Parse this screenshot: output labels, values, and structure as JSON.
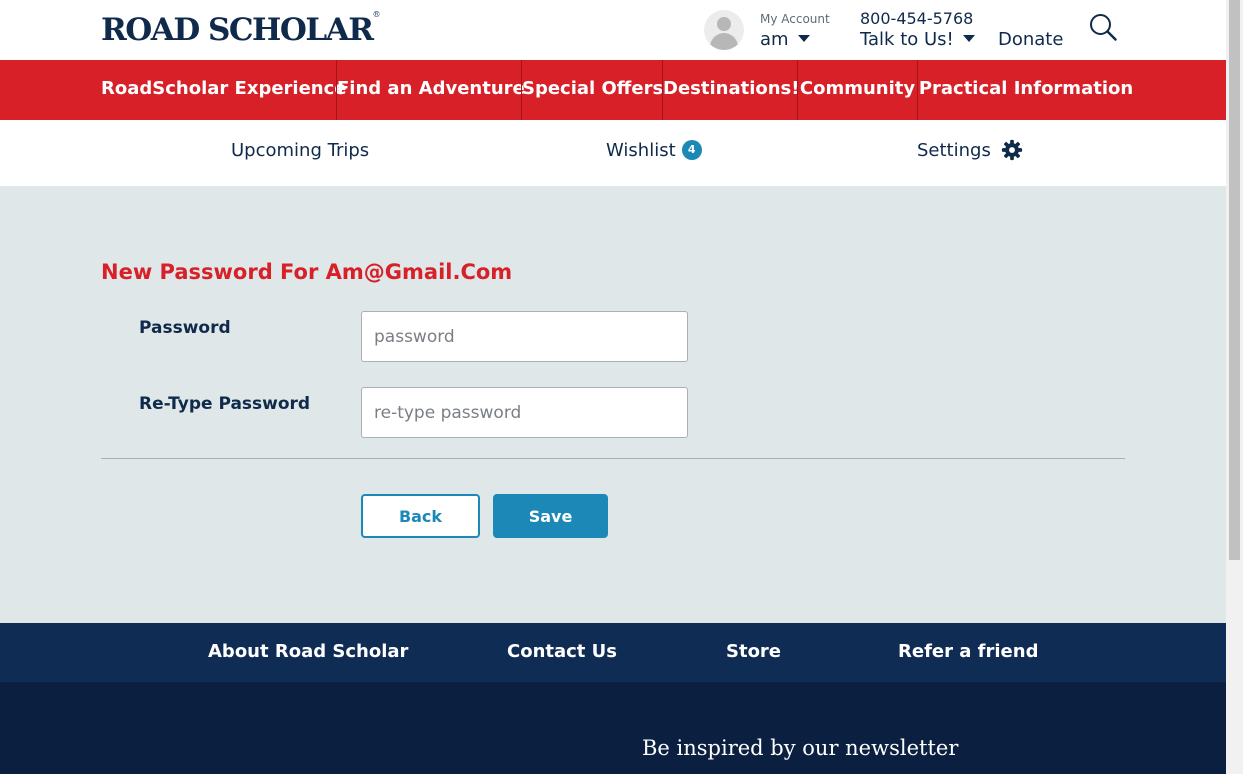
{
  "header": {
    "logo_text": "ROAD SCHOLAR",
    "logo_mark": "®",
    "account_small": "My Account",
    "account_name": "am",
    "phone": "800-454-5768",
    "talk_label": "Talk to Us!",
    "donate_label": "Donate"
  },
  "main_nav": [
    {
      "label": "RoadScholar Experience"
    },
    {
      "label": "Find an Adventure"
    },
    {
      "label": "Special Offers"
    },
    {
      "label": "Destinations!"
    },
    {
      "label": "Community"
    },
    {
      "label": "Practical Information"
    }
  ],
  "account_nav": {
    "upcoming": "Upcoming Trips",
    "wishlist": "Wishlist",
    "wishlist_count": "4",
    "settings": "Settings"
  },
  "form": {
    "title": "New Password For Am@Gmail.Com",
    "password_label": "Password",
    "password_placeholder": "password",
    "retype_label": "Re-Type Password",
    "retype_placeholder": "re-type password",
    "back_label": "Back",
    "save_label": "Save"
  },
  "footer_nav": [
    {
      "label": "About Road Scholar"
    },
    {
      "label": "Contact Us"
    },
    {
      "label": "Store"
    },
    {
      "label": "Refer a friend"
    }
  ],
  "footer": {
    "newsletter_heading": "Be inspired by our newsletter"
  },
  "colors": {
    "brand_red": "#d72028",
    "navy": "#102a4c",
    "accent_blue": "#1c88b7",
    "form_bg": "#dfe7e8",
    "footer_nav_bg": "#0f2c55",
    "footer_bg": "#0b2040"
  },
  "icons": [
    "avatar-icon",
    "chevron-down-icon",
    "search-icon",
    "gear-icon"
  ]
}
